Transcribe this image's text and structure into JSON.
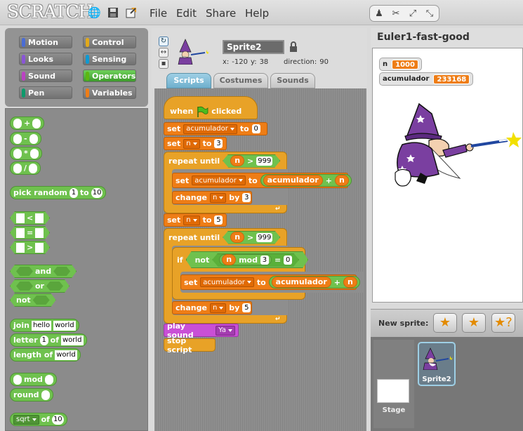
{
  "app": {
    "logo": "SCRATCH"
  },
  "menu": {
    "file": "File",
    "edit": "Edit",
    "share": "Share",
    "help": "Help"
  },
  "categories": [
    {
      "label": "Motion",
      "color": "#4a6cd4"
    },
    {
      "label": "Control",
      "color": "#e1a91a"
    },
    {
      "label": "Looks",
      "color": "#8a55d7"
    },
    {
      "label": "Sensing",
      "color": "#0e9ad3"
    },
    {
      "label": "Sound",
      "color": "#bb42c3"
    },
    {
      "label": "Operators",
      "color": "#5cb712"
    },
    {
      "label": "Pen",
      "color": "#0e9a6c"
    },
    {
      "label": "Variables",
      "color": "#ee7d16"
    }
  ],
  "palette": {
    "plus": "+",
    "minus": "-",
    "times": "*",
    "divide": "/",
    "pick_random": "pick random",
    "pick_from": "1",
    "pick_to_word": "to",
    "pick_to": "10",
    "lt": "<",
    "eq": "=",
    "gt": ">",
    "and": "and",
    "or": "or",
    "not": "not",
    "join": "join",
    "join_a": "hello",
    "join_b": "world",
    "letter": "letter",
    "letter_n": "1",
    "of": "of",
    "letter_word": "world",
    "length_of": "length of",
    "length_word": "world",
    "mod": "mod",
    "round": "round",
    "sqrt": "sqrt",
    "sqrt_of": "of",
    "sqrt_val": "10"
  },
  "sprite": {
    "name": "Sprite2",
    "x_label": "x:",
    "x": "-120",
    "y_label": "y:",
    "y": "38",
    "direction_label": "direction:",
    "direction": "90"
  },
  "tabs": {
    "scripts": "Scripts",
    "costumes": "Costumes",
    "sound": "Sounds"
  },
  "script": {
    "when": "when",
    "clicked": "clicked",
    "set": "set",
    "to": "to",
    "change": "change",
    "by": "by",
    "repeat_until": "repeat until",
    "if": "if",
    "not": "not",
    "mod": "mod",
    "var_acumulador": "acumulador",
    "var_n": "n",
    "set1_val": "0",
    "set2_val": "3",
    "cmp1": "999",
    "change1_by": "3",
    "set3_val": "5",
    "cmp2": "999",
    "mod_val": "3",
    "eq_val": "0",
    "change2_by": "5",
    "plus": "+",
    "gt": ">",
    "eq": "=",
    "play_sound": "play sound",
    "sound_name": "Ya",
    "stop_script": "stop script"
  },
  "stage": {
    "project_title": "Euler1-fast-good"
  },
  "watchers": [
    {
      "label": "n",
      "value": "1000"
    },
    {
      "label": "acumulador",
      "value": "233168"
    }
  ],
  "sprites_panel": {
    "new_sprite": "New sprite:",
    "stage_label": "Stage",
    "sprite_name": "Sprite2"
  }
}
